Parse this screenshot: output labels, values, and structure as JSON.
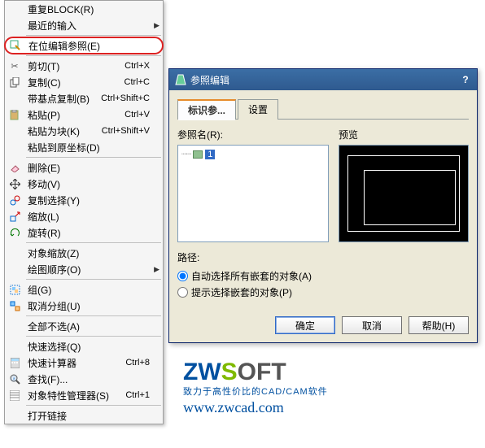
{
  "menu": {
    "repeat_block": "重复BLOCK(R)",
    "recent_input": "最近的输入",
    "edit_ref_inplace": "在位编辑参照(E)",
    "cut": {
      "label": "剪切(T)",
      "shortcut": "Ctrl+X"
    },
    "copy": {
      "label": "复制(C)",
      "shortcut": "Ctrl+C"
    },
    "copy_base": {
      "label": "带基点复制(B)",
      "shortcut": "Ctrl+Shift+C"
    },
    "paste": {
      "label": "粘贴(P)",
      "shortcut": "Ctrl+V"
    },
    "paste_block": {
      "label": "粘贴为块(K)",
      "shortcut": "Ctrl+Shift+V"
    },
    "paste_orig": "粘贴到原坐标(D)",
    "delete": "删除(E)",
    "move": "移动(V)",
    "copy_sel": "复制选择(Y)",
    "zoom": "缩放(L)",
    "rotate": "旋转(R)",
    "obj_zoom": "对象缩放(Z)",
    "draw_order": "绘图顺序(O)",
    "group": "组(G)",
    "ungroup": "取消分组(U)",
    "deselect_all": "全部不选(A)",
    "quick_sel": "快速选择(Q)",
    "calc": {
      "label": "快速计算器",
      "shortcut": "Ctrl+8"
    },
    "find": "查找(F)...",
    "props": {
      "label": "对象特性管理器(S)",
      "shortcut": "Ctrl+1"
    },
    "open_link": "打开链接"
  },
  "dialog": {
    "title": "参照编辑",
    "tab_identify": "标识参...",
    "tab_settings": "设置",
    "refname_label": "参照名(R):",
    "tree_value": "1",
    "preview_label": "预览",
    "path_label": "路径:",
    "radio_auto": "自动选择所有嵌套的对象(A)",
    "radio_prompt": "提示选择嵌套的对象(P)",
    "btn_ok": "确定",
    "btn_cancel": "取消",
    "btn_help": "帮助(H)"
  },
  "logo": {
    "tagline": "致力于高性价比的CAD/CAM软件",
    "url": "www.zwcad.com"
  }
}
